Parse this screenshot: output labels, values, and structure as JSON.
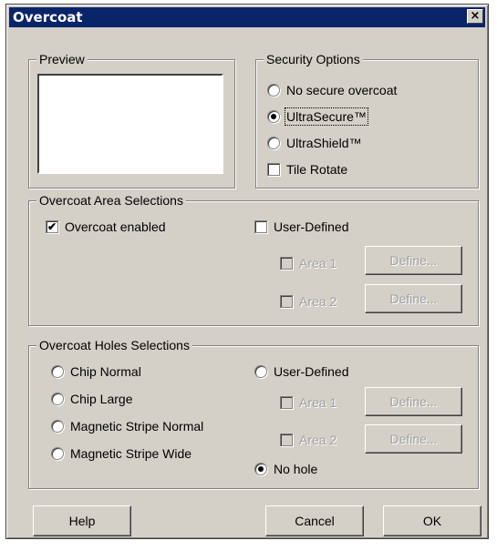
{
  "window": {
    "title": "Overcoat",
    "close_glyph": "×"
  },
  "preview": {
    "legend": "Preview"
  },
  "security": {
    "legend": "Security Options",
    "options": [
      {
        "label": "No secure overcoat",
        "selected": false
      },
      {
        "label": "UltraSecure™",
        "selected": true
      },
      {
        "label": "UltraShield™",
        "selected": false
      }
    ],
    "tile_rotate": {
      "label": "Tile Rotate",
      "checked": false
    }
  },
  "area": {
    "legend": "Overcoat Area Selections",
    "overcoat_enabled": {
      "label": "Overcoat enabled",
      "checked": true
    },
    "user_defined": {
      "label": "User-Defined",
      "checked": false
    },
    "area1": {
      "label": "Area 1",
      "checked": false,
      "enabled": false
    },
    "area2": {
      "label": "Area 2",
      "checked": false,
      "enabled": false
    },
    "define_label": "Define..."
  },
  "holes": {
    "legend": "Overcoat Holes Selections",
    "options": [
      {
        "label": "Chip Normal",
        "selected": false
      },
      {
        "label": "Chip Large",
        "selected": false
      },
      {
        "label": "Magnetic Stripe Normal",
        "selected": false
      },
      {
        "label": "Magnetic Stripe Wide",
        "selected": false
      }
    ],
    "user_defined": {
      "label": "User-Defined",
      "selected": false
    },
    "area1": {
      "label": "Area 1",
      "checked": false,
      "enabled": false
    },
    "area2": {
      "label": "Area 2",
      "checked": false,
      "enabled": false
    },
    "define_label": "Define...",
    "no_hole": {
      "label": "No hole",
      "selected": true
    }
  },
  "buttons": {
    "help": "Help",
    "cancel": "Cancel",
    "ok": "OK"
  },
  "check_glyph": "✔"
}
